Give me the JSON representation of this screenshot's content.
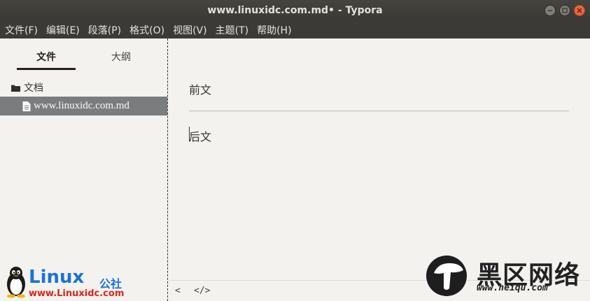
{
  "window": {
    "title": "www.linuxidc.com.md• - Typora"
  },
  "menubar": {
    "items": [
      "文件(F)",
      "编辑(E)",
      "段落(P)",
      "格式(O)",
      "视图(V)",
      "主题(T)",
      "帮助(H)"
    ]
  },
  "sidebar": {
    "tabs": [
      {
        "label": "文件",
        "active": true
      },
      {
        "label": "大纲",
        "active": false
      }
    ],
    "folder": {
      "label": "文档",
      "icon": "folder-icon"
    },
    "files": [
      {
        "label": "www.linuxidc.com.md",
        "icon": "file-icon",
        "selected": true
      }
    ]
  },
  "editor": {
    "paragraphs": [
      "前文",
      "后文"
    ]
  },
  "footer": {
    "back_label": "<",
    "source_label": "</>"
  },
  "watermarks": {
    "linux": {
      "word": "Linux",
      "cn": "公社",
      "url": "www.Linuxidc.com"
    },
    "heiqu": {
      "cn": "黑区网络",
      "url": "www.heiqu.com"
    }
  },
  "colors": {
    "selected_file_bg": "#7b7c7e",
    "close_button": "#e9683e",
    "titlebar": "#3b3a36"
  }
}
